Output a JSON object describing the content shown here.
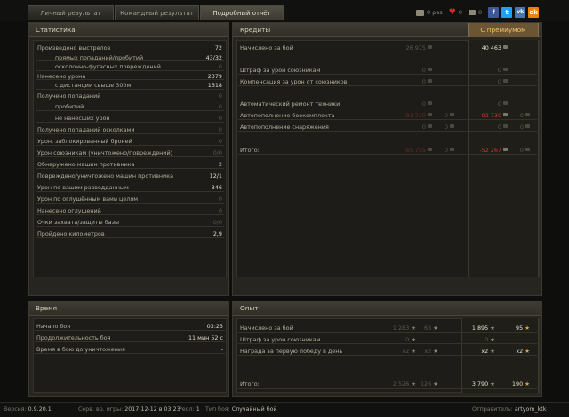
{
  "tabs": [
    {
      "label": "Личный результат"
    },
    {
      "label": "Командный результат"
    },
    {
      "label": "Подробный отчёт"
    }
  ],
  "share": {
    "views_count": "0 раз",
    "likes_count": "0",
    "comments_count": "0",
    "networks": [
      "f",
      "t",
      "vk",
      "ok"
    ]
  },
  "stats": {
    "title": "Статистика",
    "rows": [
      {
        "label": "Произведено выстрелов",
        "value": "72"
      },
      {
        "label": "прямых попаданий/пробитий",
        "value": "43/32"
      },
      {
        "label": "осколочно-фугасных повреждений",
        "value": "0"
      },
      {
        "label": "Нанесено урона",
        "value": "2379"
      },
      {
        "label": "с дистанции свыше 300м",
        "value": "1618"
      },
      {
        "label": "Получено попаданий",
        "value": "0"
      },
      {
        "label": "пробитий",
        "value": "0"
      },
      {
        "label": "не нанесших урон",
        "value": "0"
      },
      {
        "label": "Получено попаданий осколками",
        "value": "0"
      },
      {
        "label": "Урон, заблокированный броней",
        "value": "0"
      },
      {
        "label": "Урон союзникам (уничтожено/повреждений)",
        "value": "0/0"
      },
      {
        "label": "Обнаружено машин противника",
        "value": "2"
      },
      {
        "label": "Повреждено/уничтожено машин противника",
        "value": "12/1"
      },
      {
        "label": "Урон по вашим разведданным",
        "value": "346"
      },
      {
        "label": "Урон по оглушённым вами целям",
        "value": "0"
      },
      {
        "label": "Нанесено оглушений",
        "value": "0"
      },
      {
        "label": "Очки захвата/защиты базы",
        "value": "0/0"
      },
      {
        "label": "Пройдено километров",
        "value": "2,9"
      }
    ]
  },
  "credits": {
    "title": "Кредиты",
    "premium_title": "С премиумом",
    "rows": [
      {
        "label": "Начислено за бой",
        "credits": "26 975",
        "extra": "",
        "prem_credits": "40 463",
        "prem_extra": ""
      },
      {
        "label": "Штраф за урон союзникам",
        "credits": "0",
        "extra": "",
        "prem_credits": "0",
        "prem_extra": ""
      },
      {
        "label": "Компенсация за урон от союзников",
        "credits": "0",
        "extra": "",
        "prem_credits": "0",
        "prem_extra": ""
      },
      {
        "label": "Автоматический ремонт техники",
        "credits": "0",
        "extra": "",
        "prem_credits": "0",
        "prem_extra": ""
      },
      {
        "label": "Автопополнение боекомплекта",
        "credits": "-92 730",
        "extra": "0",
        "prem_credits": "-92 730",
        "prem_extra": "0"
      },
      {
        "label": "Автопополнение снаряжения",
        "credits": "0",
        "extra": "0",
        "prem_credits": "0",
        "prem_extra": "0"
      },
      {
        "label": "Итого:",
        "credits": "-65 755",
        "extra": "0",
        "prem_credits": "-52 267",
        "prem_extra": "0"
      }
    ]
  },
  "time": {
    "title": "Время",
    "rows": [
      {
        "label": "Начало боя",
        "value": "03:23"
      },
      {
        "label": "Продолжительность боя",
        "value": "11 мин 52 с"
      },
      {
        "label": "Время в бою до уничтожения",
        "value": "-"
      }
    ]
  },
  "xp": {
    "title": "Опыт",
    "rows": [
      {
        "label": "Начислено за бой",
        "xp": "1 283",
        "free": "63",
        "prem_xp": "1 895",
        "prem_free": "95"
      },
      {
        "label": "Штраф за урон союзникам",
        "xp": "0",
        "free": "",
        "prem_xp": "0",
        "prem_free": ""
      },
      {
        "label": "Награда за первую победу в день",
        "xp": "x2",
        "free": "x2",
        "prem_xp": "x2",
        "prem_free": "x2"
      },
      {
        "label": "Итого:",
        "xp": "2 526",
        "free": "126",
        "prem_xp": "3 790",
        "prem_free": "190"
      }
    ]
  },
  "footer": {
    "version_label": "Версия:",
    "version": "0.9.20.1",
    "server_label": "Серв. вр. игры:",
    "server_time": "2017-12-12 в 03:23",
    "replay_label": "Реол:",
    "replay": "1",
    "battle_type_label": "Тип боя:",
    "battle_type": "Случайный бой",
    "sender_label": "Отправитель:",
    "sender": "artyom_ktk"
  },
  "colors": {
    "accent": "#f1c06b",
    "negative": "#c23a2a",
    "premium_bg": "#6a5534"
  }
}
